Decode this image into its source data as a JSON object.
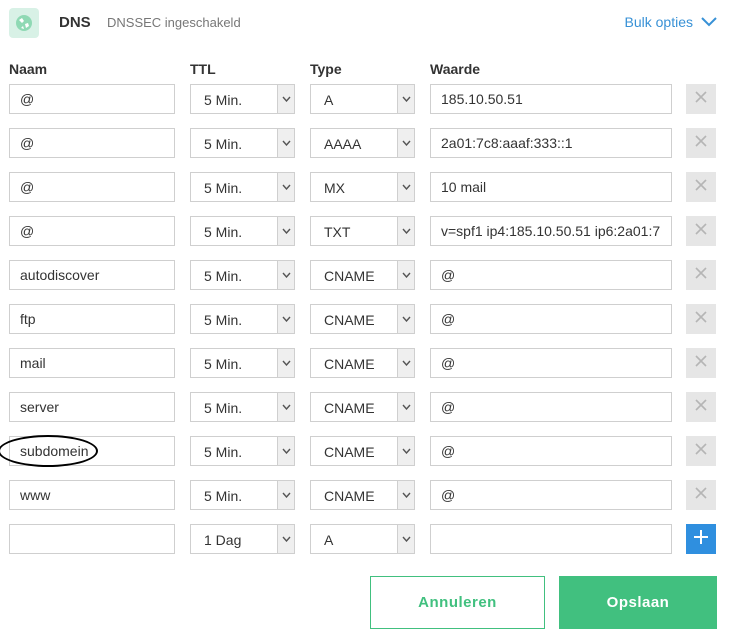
{
  "header": {
    "title": "DNS",
    "subtitle": "DNSSEC ingeschakeld",
    "bulk_label": "Bulk opties"
  },
  "columns": {
    "name": "Naam",
    "ttl": "TTL",
    "type": "Type",
    "value": "Waarde"
  },
  "records": [
    {
      "name": "@",
      "ttl": "5 Min.",
      "type": "A",
      "value": "185.10.50.51"
    },
    {
      "name": "@",
      "ttl": "5 Min.",
      "type": "AAAA",
      "value": "2a01:7c8:aaaf:333::1"
    },
    {
      "name": "@",
      "ttl": "5 Min.",
      "type": "MX",
      "value": "10 mail"
    },
    {
      "name": "@",
      "ttl": "5 Min.",
      "type": "TXT",
      "value": "v=spf1 ip4:185.10.50.51 ip6:2a01:7"
    },
    {
      "name": "autodiscover",
      "ttl": "5 Min.",
      "type": "CNAME",
      "value": "@"
    },
    {
      "name": "ftp",
      "ttl": "5 Min.",
      "type": "CNAME",
      "value": "@"
    },
    {
      "name": "mail",
      "ttl": "5 Min.",
      "type": "CNAME",
      "value": "@"
    },
    {
      "name": "server",
      "ttl": "5 Min.",
      "type": "CNAME",
      "value": "@"
    },
    {
      "name": "subdomein",
      "ttl": "5 Min.",
      "type": "CNAME",
      "value": "@"
    },
    {
      "name": "www",
      "ttl": "5 Min.",
      "type": "CNAME",
      "value": "@"
    }
  ],
  "new_record": {
    "name": "",
    "ttl": "1 Dag",
    "type": "A",
    "value": ""
  },
  "buttons": {
    "cancel": "Annuleren",
    "save": "Opslaan"
  },
  "colors": {
    "accent": "#41c07f",
    "link": "#3891d6",
    "add": "#2f8fdf"
  },
  "icons": {
    "logo": "globe-icon",
    "bulk": "chevron-down-icon",
    "delete": "close-icon",
    "add": "plus-icon",
    "select": "caret-down-icon"
  }
}
